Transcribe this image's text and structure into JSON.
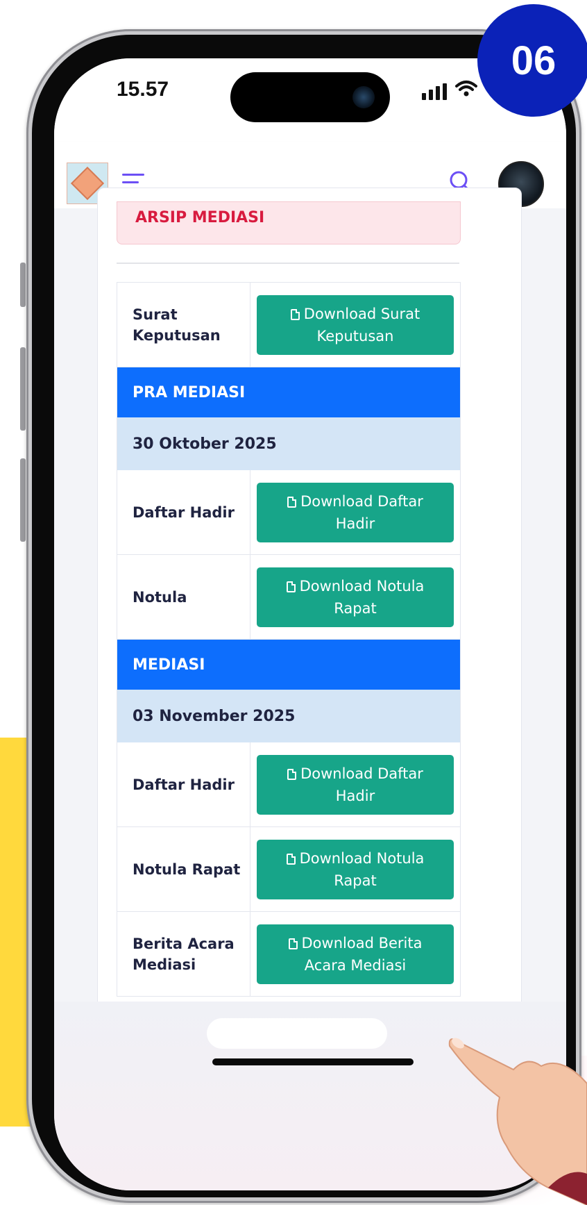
{
  "status_bar": {
    "time": "15.57"
  },
  "step_badge": "06",
  "archive_header": "ARSIP MEDIASI",
  "top_rows": [
    {
      "label": "Surat Keputusan",
      "button": "Download Surat Keputusan"
    }
  ],
  "pra_mediasi": {
    "title": "PRA MEDIASI",
    "date": "30 Oktober 2025",
    "rows": [
      {
        "label": "Daftar Hadir",
        "button": "Download Daftar Hadir"
      },
      {
        "label": "Notula",
        "button": "Download Notula Rapat"
      }
    ]
  },
  "mediasi": {
    "title": "MEDIASI",
    "date": "03 November 2025",
    "rows": [
      {
        "label": "Daftar Hadir",
        "button": "Download Daftar Hadir"
      },
      {
        "label": "Notula Rapat",
        "button": "Download Notula Rapat"
      },
      {
        "label": "Berita Acara Mediasi",
        "button": "Download Berita Acara Mediasi"
      }
    ]
  },
  "icons": {
    "menu": "hamburger-menu-icon",
    "search": "search-icon",
    "document": "file-icon",
    "wifi": "wifi-icon",
    "signal": "cellular-signal-icon"
  },
  "colors": {
    "accent_purple": "#6c4ff5",
    "section_blue": "#0d6efd",
    "date_row": "#d4e5f6",
    "download_button": "#17a589",
    "alert_text": "#d81b3f",
    "badge": "#0b22b8",
    "highlight_yellow": "#ffd93d"
  }
}
